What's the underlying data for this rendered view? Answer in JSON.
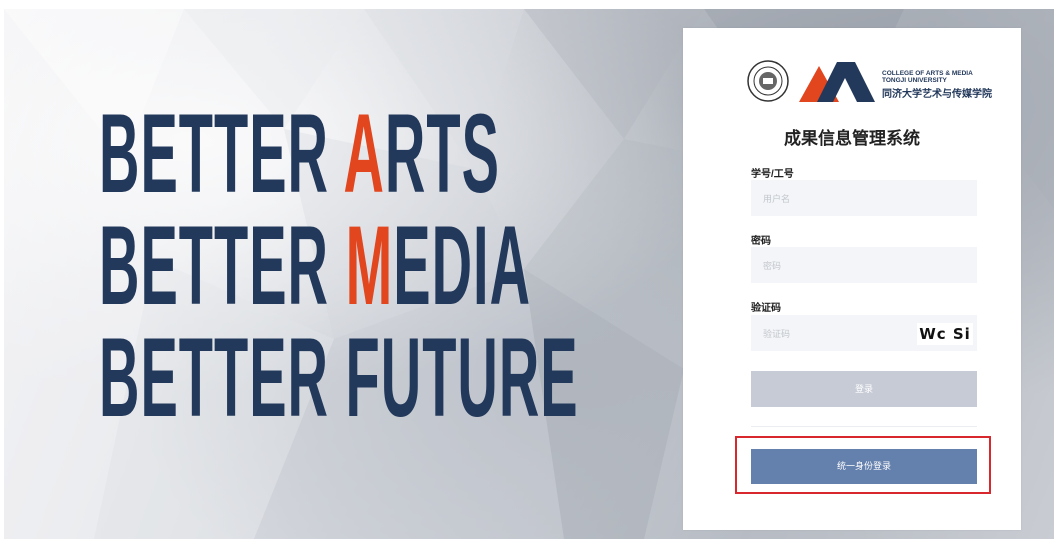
{
  "hero": {
    "line1_prefix": "BETTER ",
    "line1_highlight": "A",
    "line1_suffix": "RTS",
    "line2_prefix": "BETTER ",
    "line2_highlight": "M",
    "line2_suffix": "EDIA",
    "line3": "BETTER FUTURE"
  },
  "branding": {
    "college_en": "COLLEGE OF ARTS & MEDIA\nTONGJI UNIVERSITY",
    "college_cn": "同济大学艺术与传媒学院"
  },
  "login": {
    "title": "成果信息管理系统",
    "username_label": "学号/工号",
    "username_placeholder": "用户名",
    "password_label": "密码",
    "password_placeholder": "密码",
    "captcha_label": "验证码",
    "captcha_placeholder": "验证码",
    "captcha_text": "Wc Si",
    "login_button": "登录",
    "sso_button": "统一身份登录"
  },
  "colors": {
    "navy": "#23395b",
    "accent_orange": "#e1461f",
    "sso_blue": "#6480ad",
    "login_disabled": "#c7cbd6",
    "highlight_box": "#d9272e"
  }
}
